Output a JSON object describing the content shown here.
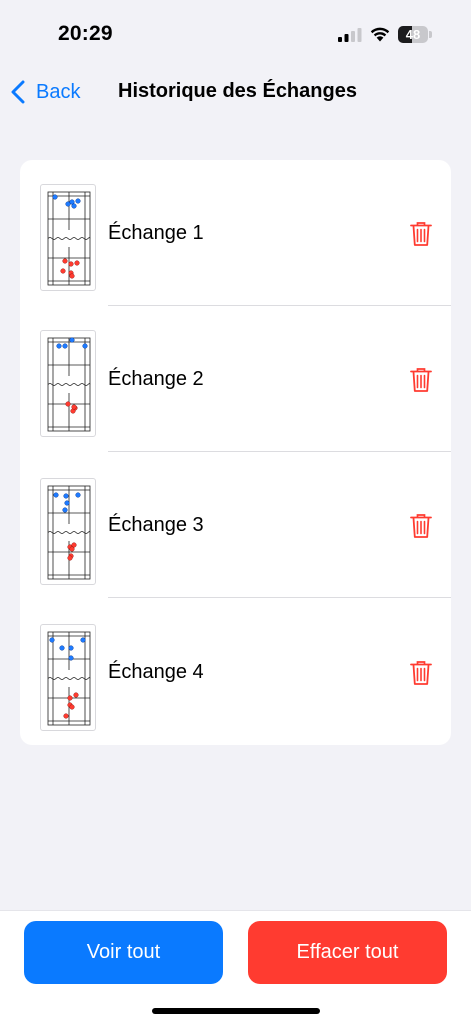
{
  "status_bar": {
    "time": "20:29",
    "battery_level": "48",
    "battery_percent": 48,
    "signal_bars_active": 2,
    "signal_bars_total": 4
  },
  "nav": {
    "back_label": "Back",
    "title": "Historique des Échanges",
    "accent_color": "#0a7aff"
  },
  "list": {
    "items": [
      {
        "label": "Échange 1",
        "icon": "trash-icon"
      },
      {
        "label": "Échange 2",
        "icon": "trash-icon"
      },
      {
        "label": "Échange 3",
        "icon": "trash-icon"
      },
      {
        "label": "Échange 4",
        "icon": "trash-icon"
      }
    ],
    "delete_color": "#ff3b30"
  },
  "actions": {
    "view_all_label": "Voir tout",
    "clear_all_label": "Effacer tout",
    "view_all_color": "#0a7aff",
    "clear_all_color": "#ff3b30"
  },
  "thumb_colors": {
    "team_top": "#1e7bff",
    "team_bottom": "#ff3b30"
  }
}
